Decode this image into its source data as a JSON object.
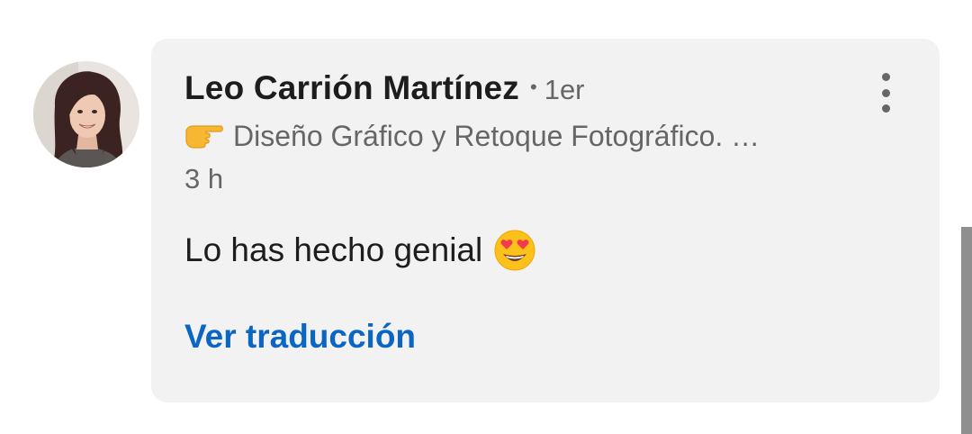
{
  "comment": {
    "author_name": "Leo Carrión Martínez",
    "degree_separator": "•",
    "connection_degree": "1er",
    "headline": "Diseño Gráfico y Retoque Fotográfico. …",
    "headline_icon": "backhand-index-pointing-right-emoji",
    "timestamp": "3 h",
    "text": "Lo has hecho genial",
    "text_emoji": "smiling-face-with-heart-eyes-emoji",
    "translate_label": "Ver traducción",
    "more_icon": "vertical-ellipsis-icon"
  },
  "colors": {
    "card_background": "#f2f2f2",
    "primary_text": "#1d1d1d",
    "secondary_text": "#666666",
    "link": "#0a66c2"
  }
}
